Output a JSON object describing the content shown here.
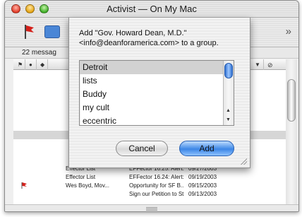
{
  "window": {
    "title": "Activist — On My Mac"
  },
  "toolbar": {
    "overflow_glyph": "»"
  },
  "message_count": "22 messag",
  "message_rows": [
    {
      "from": "",
      "subject": "",
      "date": ""
    },
    {
      "from": "",
      "subject": "",
      "date": ""
    },
    {
      "from": "",
      "subject": "",
      "date": ""
    },
    {
      "from": "",
      "subject": "",
      "date": ""
    },
    {
      "from": "",
      "subject": "",
      "date": ""
    },
    {
      "from": "",
      "subject": "",
      "date": ""
    },
    {
      "from": "",
      "subject": "",
      "date": ""
    },
    {
      "from": "",
      "subject": "",
      "date": "03"
    },
    {
      "from": "",
      "subject": "",
      "date": "03"
    },
    {
      "from": "",
      "subject": "",
      "date": "03"
    },
    {
      "from": "",
      "subject": "",
      "date": "03"
    },
    {
      "from": "Effector List",
      "subject": "EFFector 16.25: Alert:...",
      "date": "09/27/2003"
    },
    {
      "from": "Effector List",
      "subject": "EFFector 16.24: Alert:...",
      "date": "09/19/2003"
    },
    {
      "from": "Wes Boyd, Mov...",
      "subject": "Opportunity for SF B...",
      "date": "09/15/2003"
    },
    {
      "from": "",
      "subject": "Sign our Petition to St...",
      "date": "09/13/2003"
    }
  ],
  "sheet": {
    "line1": "Add \"Gov. Howard Dean, M.D.\"",
    "line2": "<info@deanforamerica.com> to a group.",
    "groups": [
      "Detroit",
      "lists",
      "Buddy",
      "my cult",
      "eccentric"
    ],
    "selected_index": 0,
    "cancel_label": "Cancel",
    "add_label": "Add"
  }
}
